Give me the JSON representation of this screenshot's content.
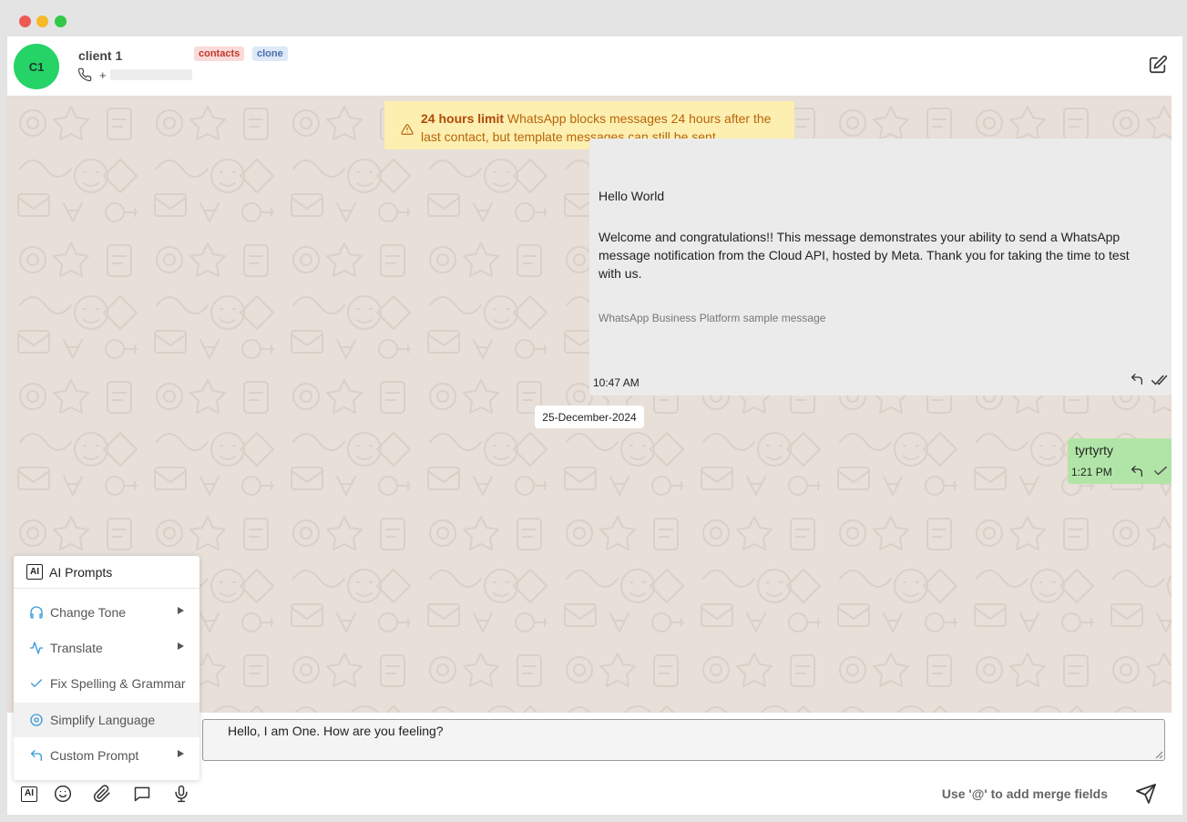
{
  "window": {
    "controls": [
      "close",
      "minimize",
      "maximize"
    ]
  },
  "contact": {
    "initials": "C1",
    "name": "client 1",
    "phone_prefix": "+",
    "tags": [
      "contacts",
      "clone"
    ],
    "avatar_color": "#25d366"
  },
  "notice": {
    "title": "24 hours limit",
    "text": " WhatsApp blocks messages 24 hours after the last contact, but template messages can still be sent."
  },
  "messages": [
    {
      "heading": "Hello World",
      "body": "Welcome and congratulations!! This message demonstrates your ability to send a WhatsApp message notification from the Cloud API, hosted by Meta. Thank you for taking the time to test with us.",
      "footer": "WhatsApp Business Platform sample message",
      "time": "10:47 AM",
      "status": "double-tick-icon"
    },
    {
      "text": "tyrtyrty",
      "time": "1:21 PM",
      "status": "single-tick-icon",
      "bubble_color": "#b1e5a8"
    }
  ],
  "date_separator": "25-December-2024",
  "composer": {
    "value": "Hello, I am One. How are you feeling?"
  },
  "toolbar": {
    "ai_label": "AI",
    "merge_hint": "Use '@' to add merge fields",
    "icons": [
      "ai-icon",
      "emoji-icon",
      "paperclip-icon",
      "comment-icon",
      "microphone-icon",
      "send-icon"
    ]
  },
  "ai_menu": {
    "title": "AI Prompts",
    "badge": "AI",
    "items": [
      {
        "label": "Change Tone",
        "icon": "headphones-icon",
        "submenu": true
      },
      {
        "label": "Translate",
        "icon": "activity-icon",
        "submenu": true
      },
      {
        "label": "Fix Spelling & Grammar",
        "icon": "check-icon",
        "submenu": false
      },
      {
        "label": "Simplify Language",
        "icon": "target-icon",
        "submenu": false
      },
      {
        "label": "Custom Prompt",
        "icon": "reply-icon",
        "submenu": true
      }
    ],
    "accent_color": "#3a9ad9"
  }
}
